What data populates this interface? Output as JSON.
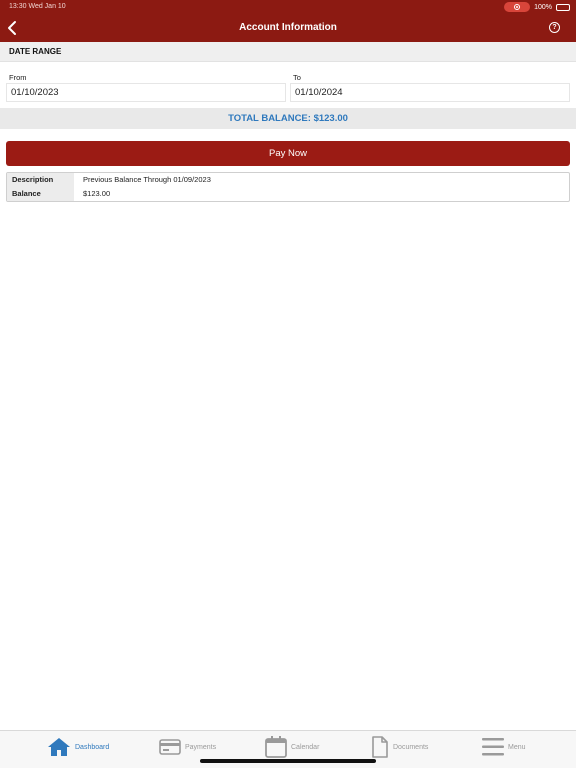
{
  "status": {
    "time": "13:30  Wed Jan 10",
    "battery": "100%"
  },
  "header": {
    "title": "Account Information"
  },
  "date_range": {
    "title": "DATE RANGE",
    "from_label": "From",
    "from_value": "01/10/2023",
    "to_label": "To",
    "to_value": "01/10/2024"
  },
  "balance": {
    "text": "TOTAL BALANCE: $123.00"
  },
  "pay_button": {
    "label": "Pay Now"
  },
  "details": {
    "rows": [
      {
        "key": "Description",
        "value": "Previous Balance Through 01/09/2023"
      },
      {
        "key": "Balance",
        "value": "$123.00"
      }
    ]
  },
  "tabs": [
    {
      "label": "Dashboard",
      "icon": "home-icon",
      "active": true
    },
    {
      "label": "Payments",
      "icon": "credit-card-icon",
      "active": false
    },
    {
      "label": "Calendar",
      "icon": "calendar-icon",
      "active": false
    },
    {
      "label": "Documents",
      "icon": "document-icon",
      "active": false
    },
    {
      "label": "Menu",
      "icon": "menu-icon",
      "active": false
    }
  ],
  "colors": {
    "header": "#8c1a12",
    "button": "#9b1b14",
    "accent": "#2f79bd"
  }
}
